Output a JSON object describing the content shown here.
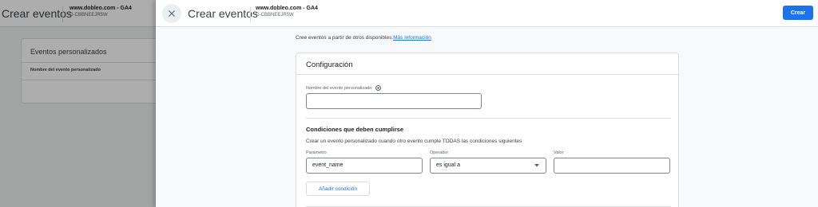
{
  "background": {
    "title": "Crear eventos",
    "property_name": "www.dobleo.com - GA4",
    "property_id": "G-CBBNEEJR5W",
    "card_title": "Eventos personalizados",
    "column_header": "Nombre del evento personalizado"
  },
  "panel": {
    "close_icon": "close-icon",
    "title": "Crear eventos",
    "property_name": "www.dobleo.com - GA4",
    "property_id": "G-CBBNEEJR5W",
    "create_label": "Crear",
    "intro_text": "Cree eventos a partir de otros disponibles.",
    "intro_link": "Más información"
  },
  "config": {
    "title": "Configuración",
    "name_label": "Nombre del evento personalizado",
    "name_help_icon": "help-icon",
    "name_value": "",
    "conditions_title": "Condiciones que deben cumplirse",
    "conditions_desc": "Crear un evento personalizado cuando otro evento cumple TODAS las condiciones siguientes",
    "param_label": "Parámetro",
    "param_value": "event_name",
    "operator_label": "Operador",
    "operator_value": "es igual a",
    "value_label": "Valor",
    "value_value": "",
    "add_condition_label": "Añadir condición"
  },
  "colors": {
    "accent": "#1a73e8",
    "overlay": "rgba(0,0,0,0.32)"
  }
}
